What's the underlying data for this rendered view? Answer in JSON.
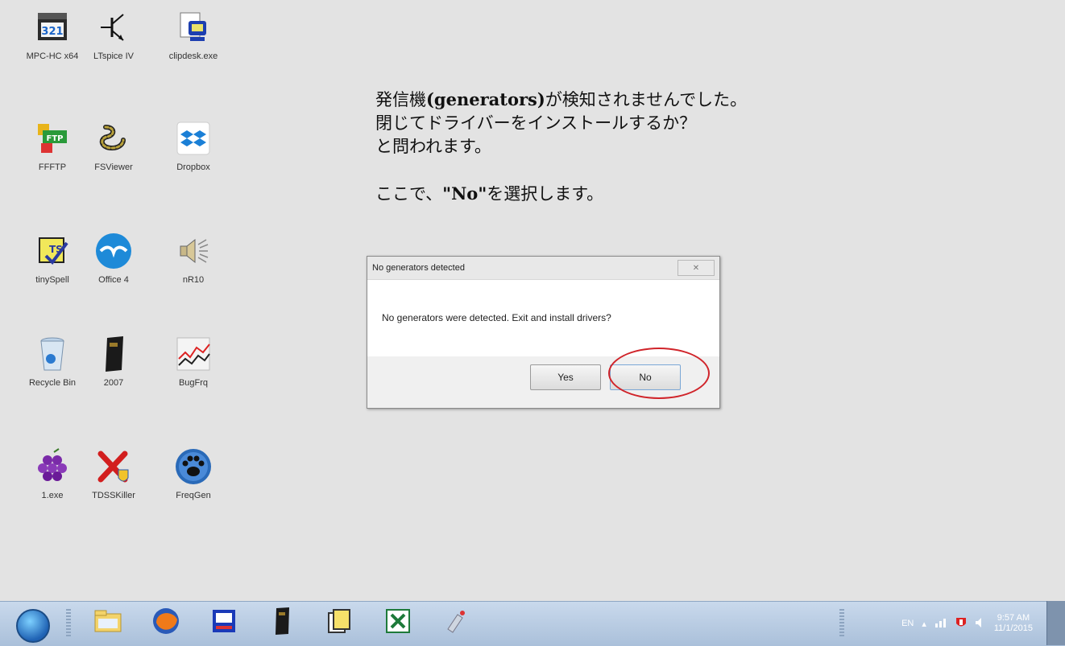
{
  "desktop_icons": [
    {
      "label": "MPC-HC x64",
      "icon": "media-player-icon"
    },
    {
      "label": "LTspice IV",
      "icon": "transistor-icon"
    },
    {
      "label": "clipdesk.exe",
      "icon": "clipboard-monitor-icon"
    },
    {
      "label": "FFFTP",
      "icon": "ftp-icon"
    },
    {
      "label": "FSViewer",
      "icon": "snake-icon"
    },
    {
      "label": "Dropbox",
      "icon": "dropbox-icon"
    },
    {
      "label": "tinySpell",
      "icon": "spellcheck-icon"
    },
    {
      "label": "Office 4",
      "icon": "seagull-icon"
    },
    {
      "label": "nR10",
      "icon": "speaker-icon"
    },
    {
      "label": "Recycle Bin",
      "icon": "recycle-bin-icon"
    },
    {
      "label": "2007",
      "icon": "black-book-icon"
    },
    {
      "label": "BugFrq",
      "icon": "graph-icon"
    },
    {
      "label": "1.exe",
      "icon": "grapes-icon"
    },
    {
      "label": "TDSSKiller",
      "icon": "red-x-shield-icon"
    },
    {
      "label": "FreqGen",
      "icon": "paw-icon"
    }
  ],
  "note": {
    "line1_pre": "発信機",
    "line1_bold": "(generators)",
    "line1_post": "が検知されませんでした。",
    "line2": "閉じてドライバーをインストールするか？",
    "line3": "と問われます。",
    "line4_pre": "ここで、",
    "line4_bold": "\"No\"",
    "line4_post": "を選択します。"
  },
  "dialog": {
    "title": "No generators detected",
    "message": "No generators were detected. Exit and install drivers?",
    "yes_label": "Yes",
    "no_label": "No",
    "close_symbol": "✕"
  },
  "highlight_color": "#d0242a",
  "taskbar": {
    "pinned": [
      "explorer-icon",
      "firefox-icon",
      "app-icon",
      "book-icon",
      "documents-icon",
      "excel-icon",
      "paint-icon"
    ],
    "language": "EN",
    "time": "9:57 AM",
    "date": "11/1/2015"
  }
}
